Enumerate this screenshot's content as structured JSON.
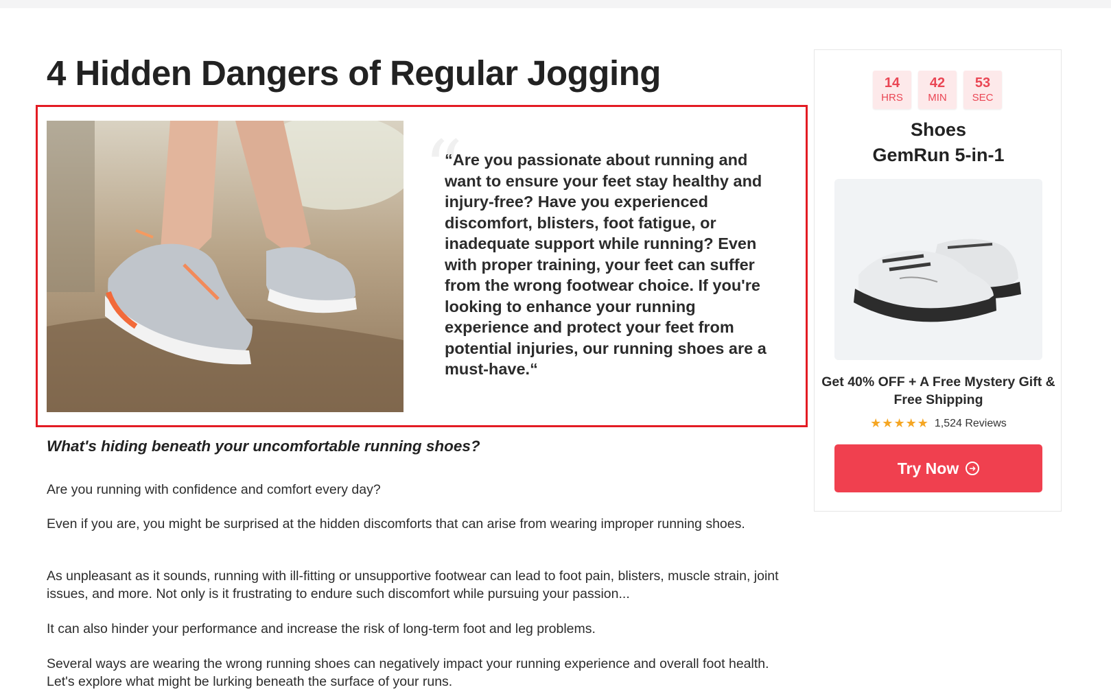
{
  "article": {
    "title": "4 Hidden Dangers of Regular Jogging",
    "quote": "“Are you passionate about running and want to ensure your feet stay healthy and injury-free? Have you experienced discomfort, blisters, foot fatigue, or inadequate support while running? Even with proper training, your feet can suffer from the wrong footwear choice. If you're looking to enhance your running experience and protect your feet from potential injuries, our running shoes are a must-have.“",
    "subheading": "What's hiding beneath your uncomfortable running shoes?",
    "paragraphs": [
      "Are you running with confidence and comfort every day?",
      "Even if you are, you might be surprised at the hidden discomforts that can arise from wearing improper running shoes.",
      "As unpleasant as it sounds, running with ill-fitting or unsupportive footwear can lead to foot pain, blisters, muscle strain, joint issues, and more. Not only is it frustrating to endure such discomfort while pursuing your passion...",
      "It can also hinder your performance and increase the risk of long-term foot and leg problems.",
      "Several ways are wearing the wrong running shoes can negatively impact your running experience and overall foot health. Let's explore what might be lurking beneath the surface of your runs."
    ]
  },
  "sidebar": {
    "timer": [
      {
        "value": "14",
        "unit": "HRS"
      },
      {
        "value": "42",
        "unit": "MIN"
      },
      {
        "value": "53",
        "unit": "SEC"
      }
    ],
    "product_line1": "Shoes",
    "product_line2": "GemRun 5-in-1",
    "offer": "Get 40% OFF + A Free Mystery Gift & Free Shipping",
    "stars": "★★★★★",
    "reviews": "1,524 Reviews",
    "cta_label": "Try Now",
    "cta_icon": "arrow-circle-icon"
  },
  "colors": {
    "accent": "#f0404f",
    "highlight_border": "#e31b23",
    "timer_bg": "#fde9ea",
    "timer_text": "#ea4654",
    "star": "#f5a623"
  }
}
